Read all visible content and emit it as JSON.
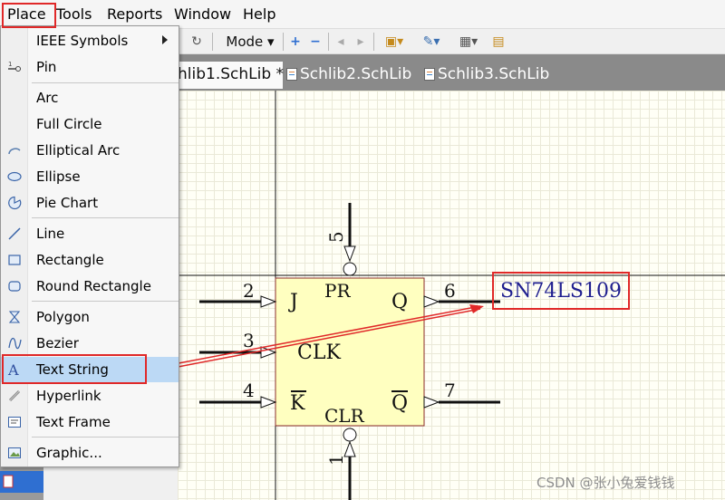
{
  "menubar": {
    "items": [
      "Place",
      "Tools",
      "Reports",
      "Window",
      "Help"
    ]
  },
  "toolbar": {
    "mode_label": "Mode",
    "icons": [
      "redo-icon",
      "add-icon",
      "remove-icon",
      "back-icon",
      "forward-icon",
      "component-icon",
      "edit-icon",
      "grid-icon",
      "folder-icon"
    ]
  },
  "tabs": [
    {
      "label": "hlib1.SchLib *",
      "active": true
    },
    {
      "label": "Schlib2.SchLib",
      "active": false
    },
    {
      "label": "Schlib3.SchLib",
      "active": false
    }
  ],
  "place_menu": {
    "items": [
      {
        "label": "IEEE Symbols",
        "icon": "none",
        "submenu": true
      },
      {
        "label": "Pin",
        "icon": "pin-icon"
      },
      {
        "label": "Arc",
        "icon": "none"
      },
      {
        "label": "Full Circle",
        "icon": "none"
      },
      {
        "label": "Elliptical Arc",
        "icon": "elliptical-arc-icon"
      },
      {
        "label": "Ellipse",
        "icon": "ellipse-icon"
      },
      {
        "label": "Pie Chart",
        "icon": "pie-chart-icon"
      },
      {
        "label": "Line",
        "icon": "line-icon"
      },
      {
        "label": "Rectangle",
        "icon": "rectangle-icon"
      },
      {
        "label": "Round Rectangle",
        "icon": "round-rectangle-icon"
      },
      {
        "label": "Polygon",
        "icon": "polygon-icon"
      },
      {
        "label": "Bezier",
        "icon": "bezier-icon"
      },
      {
        "label": "Text String",
        "icon": "text-string-icon",
        "highlighted": true
      },
      {
        "label": "Hyperlink",
        "icon": "hyperlink-icon"
      },
      {
        "label": "Text Frame",
        "icon": "text-frame-icon"
      },
      {
        "label": "Graphic...",
        "icon": "graphic-icon"
      }
    ]
  },
  "schematic": {
    "part_text": "SN74LS109",
    "pins": {
      "j_num": "2",
      "j_name": "J",
      "clk_num": "3",
      "clk_name": "CLK",
      "k_num": "4",
      "k_name": "K",
      "q_num": "6",
      "q_name": "Q",
      "qbar_num": "7",
      "qbar_name": "Q",
      "pr_num": "5",
      "pr_name": "PR",
      "clr_num": "1",
      "clr_name": "CLR"
    },
    "colors": {
      "body_fill": "#ffffc0",
      "body_stroke": "#8b2c2c",
      "text_string": "#1f1f8f",
      "annotation_red": "#e02828"
    }
  },
  "watermark": "CSDN @张小兔爱钱钱"
}
